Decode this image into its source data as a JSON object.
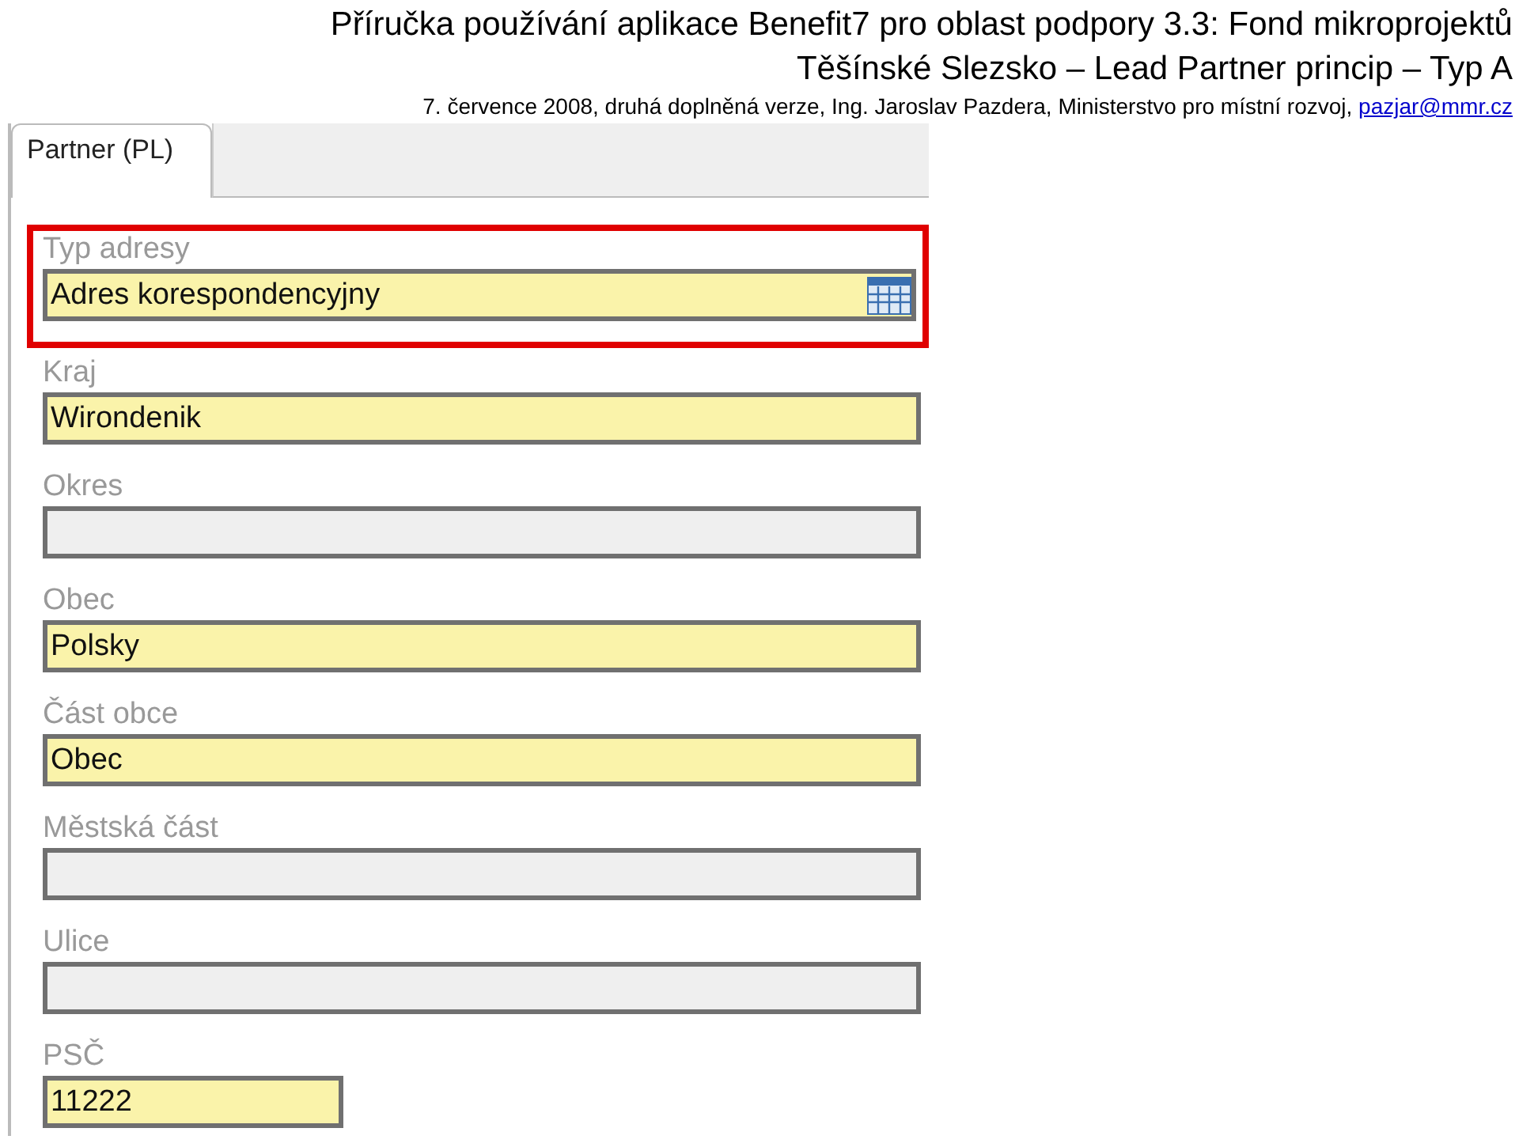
{
  "header": {
    "title": "Příručka používání aplikace Benefit7 pro oblast podpory 3.3: Fond mikroprojektů",
    "subtitle": "Těšínské Slezsko – Lead Partner princip – Typ A",
    "byline": "7. července 2008, druhá doplněná verze, Ing. Jaroslav Pazdera, Ministerstvo pro místní rozvoj,",
    "email": "pazjar@mmr.cz"
  },
  "tabs": [
    {
      "label": "Partner (PL)",
      "selected": true
    }
  ],
  "fields": [
    {
      "label": "Typ adresy",
      "value": "Adres korespondencyjny",
      "kind": "picker",
      "required": true,
      "highlighted": true
    },
    {
      "label": "Kraj",
      "value": "Wirondenik",
      "kind": "text",
      "required": true,
      "highlighted": false
    },
    {
      "label": "Okres",
      "kind": "text",
      "required": false,
      "highlighted": false
    },
    {
      "label": "Obec",
      "value": "Polsky",
      "kind": "text",
      "required": true,
      "highlighted": false
    },
    {
      "label": "Část obce",
      "value": "Obec",
      "kind": "text",
      "required": true,
      "highlighted": false
    },
    {
      "label": "Městská část",
      "kind": "text",
      "required": false,
      "highlighted": false
    },
    {
      "label": "Ulice",
      "kind": "text",
      "required": false,
      "highlighted": false
    },
    {
      "label": "PSČ",
      "value": "11222",
      "kind": "short",
      "required": true,
      "highlighted": false
    }
  ]
}
